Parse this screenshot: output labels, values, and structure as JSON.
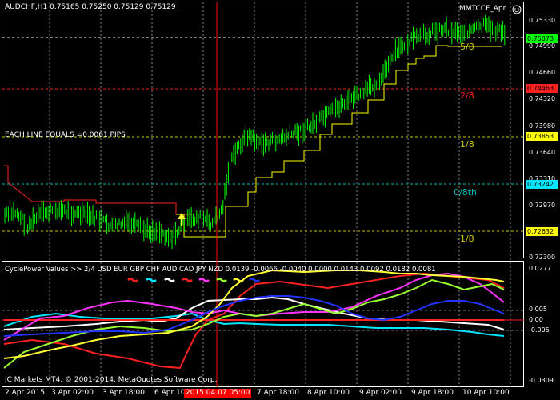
{
  "window": {
    "symbol_line": "AUDCHF,H1  0.75165 0.75250 0.75129 0.75129",
    "indicator_tag": "MMTCCF_Apr",
    "crosshair_time": "2015.04.07 05:00",
    "copyright": "IC Markets MT4, © 2001-2014, MetaQuotes Software Corp."
  },
  "main_panel": {
    "annotation": "EACH LINE EQUALS =0.0061 PIPS",
    "level_labels": {
      "five_eighths": "5/8",
      "two_eighths": "2/8",
      "one_eighth": "1/8",
      "zero_eighth": "0/8th",
      "minus_one_eighth": "-1/8"
    },
    "level_prices": {
      "current": "0.75073",
      "two_eighths": "0.74463",
      "one_eighth": "0.73853",
      "zero_eighth": "0.73242",
      "minus_one_eighth": "0.72632"
    },
    "price_ticks": [
      "0.75330",
      "0.74990",
      "0.74660",
      "0.74320",
      "0.73980",
      "0.73640",
      "0.73310",
      "0.72970",
      "0.72300"
    ],
    "colors": {
      "candles": "#00ff00",
      "grid_cyan": "#00bfbf",
      "grid_red": "#ff2020",
      "grid_yellow": "#cccc00",
      "grid_gray": "#808080",
      "trail_yellow": "#ffff00",
      "trail_red": "#ff2020",
      "crosshair": "#ff0000"
    }
  },
  "sub_panel": {
    "header": "CyclePower  Values >> 2/4 USD EUR GBP CHF AUD CAD JPY NZD 0.0139 -0.0066 -0.0040 0.0000 0.0143 0.0092 0.0182 0.0081",
    "ticks": [
      "0.0277",
      "0.005",
      "0.00",
      "-0.005",
      "-0.0309"
    ],
    "currencies": [
      {
        "code": "USD",
        "color": "#ff2020"
      },
      {
        "code": "EUR",
        "color": "#00e5ff"
      },
      {
        "code": "GBP",
        "color": "#ffffff"
      },
      {
        "code": "CHF",
        "color": "#ff2020"
      },
      {
        "code": "AUD",
        "color": "#ff33ff"
      },
      {
        "code": "CAD",
        "color": "#99ff33"
      },
      {
        "code": "JPY",
        "color": "#ffff33"
      },
      {
        "code": "NZD",
        "color": "#2233ff"
      }
    ]
  },
  "time_axis": [
    "2 Apr 2015",
    "3 Apr 02:00",
    "3 Apr 18:00",
    "6 Apr 10:00",
    "7 Apr 18:00",
    "8 Apr 10:00",
    "9 Apr 02:00",
    "9 Apr 18:00",
    "10 Apr 10:00"
  ]
}
